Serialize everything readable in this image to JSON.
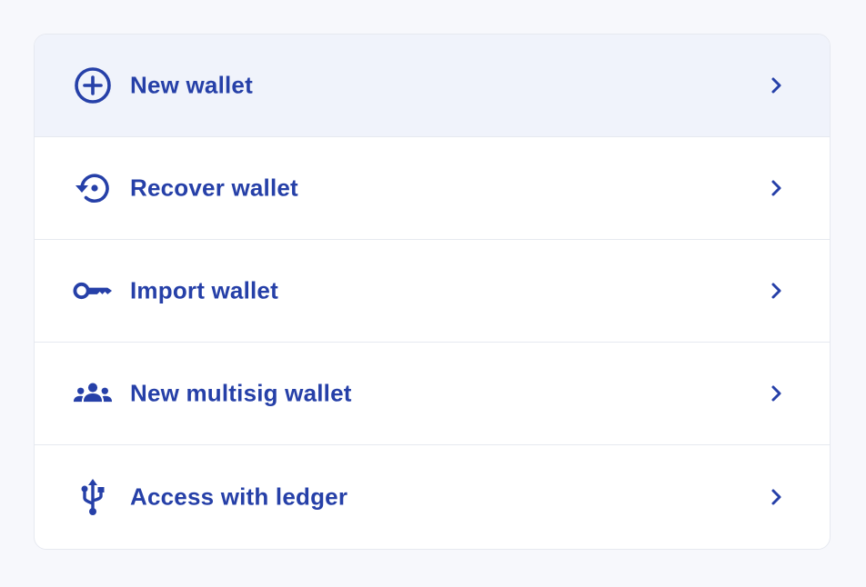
{
  "colors": {
    "accent": "#2640a8",
    "page_background": "#f7f8fc",
    "card_background": "#ffffff",
    "active_row_background": "#f0f3fb",
    "divider": "#e6e9f0"
  },
  "menu": {
    "items": [
      {
        "label": "New wallet",
        "icon": "plus-circle-icon",
        "active": true
      },
      {
        "label": "Recover wallet",
        "icon": "restore-icon",
        "active": false
      },
      {
        "label": "Import wallet",
        "icon": "key-icon",
        "active": false
      },
      {
        "label": "New multisig wallet",
        "icon": "group-icon",
        "active": false
      },
      {
        "label": "Access with ledger",
        "icon": "usb-icon",
        "active": false
      }
    ],
    "chevron_icon": "chevron-right-icon"
  }
}
